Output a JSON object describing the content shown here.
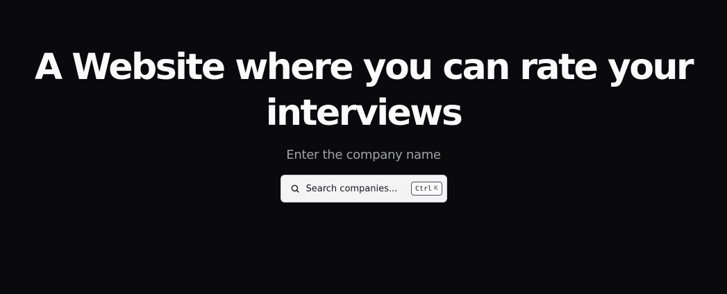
{
  "hero": {
    "title": "A Website where you can rate your interviews",
    "subtitle": "Enter the company name"
  },
  "search": {
    "placeholder": "Search companies...",
    "icon": "search-icon",
    "shortcut_ctrl": "Ctrl",
    "shortcut_key": "K"
  },
  "colors": {
    "background": "#0a0a0c",
    "title": "#fafafa",
    "subtitle": "#a1a1aa",
    "search_bg": "#f4f4f5"
  }
}
